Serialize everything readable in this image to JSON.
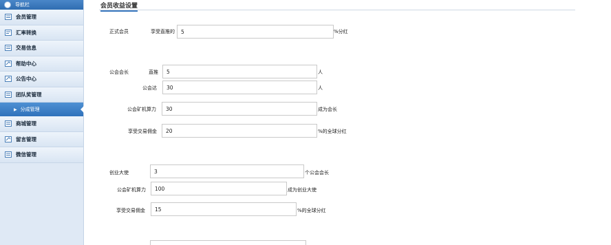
{
  "sidebar": {
    "top_label": "导航栏",
    "items": [
      {
        "label": "会员管理",
        "icon": "user-icon"
      },
      {
        "label": "汇率转换",
        "icon": "exchange-icon"
      },
      {
        "label": "交易信息",
        "icon": "list-icon"
      },
      {
        "label": "帮助中心",
        "icon": "help-icon"
      },
      {
        "label": "公告中心",
        "icon": "notice-icon"
      },
      {
        "label": "团队奖管理",
        "icon": "team-icon"
      }
    ],
    "active_sub": "分成管理",
    "items_after": [
      {
        "label": "商城管理",
        "icon": "shop-icon"
      },
      {
        "label": "留言管理",
        "icon": "message-icon"
      },
      {
        "label": "微信管理",
        "icon": "wechat-icon"
      }
    ]
  },
  "main": {
    "title": "会员收益设置",
    "official_member": {
      "group_label": "正式会员",
      "field_label": "享受直推的",
      "value": "5",
      "suffix": "%分红"
    },
    "guild_leader": {
      "group_label": "公会会长",
      "direct_label": "直推",
      "direct_value": "5",
      "direct_suffix": "人",
      "guild_label": "公会达",
      "guild_value": "30",
      "guild_suffix": "人",
      "hash_label": "公会矿机算力",
      "hash_value": "30",
      "hash_suffix": "成为会长",
      "fee_label": "享受交易佣金",
      "fee_value": "20",
      "fee_suffix": "%的全球分红"
    },
    "ambassador": {
      "group_label": "创业大使",
      "count_value": "3",
      "count_suffix": "个公会会长",
      "hash_label": "公会矿机算力",
      "hash_value": "100",
      "hash_suffix": "成为创业大使",
      "fee_label": "享受交易佣金",
      "fee_value": "15",
      "fee_suffix": "%的全球分红"
    }
  }
}
